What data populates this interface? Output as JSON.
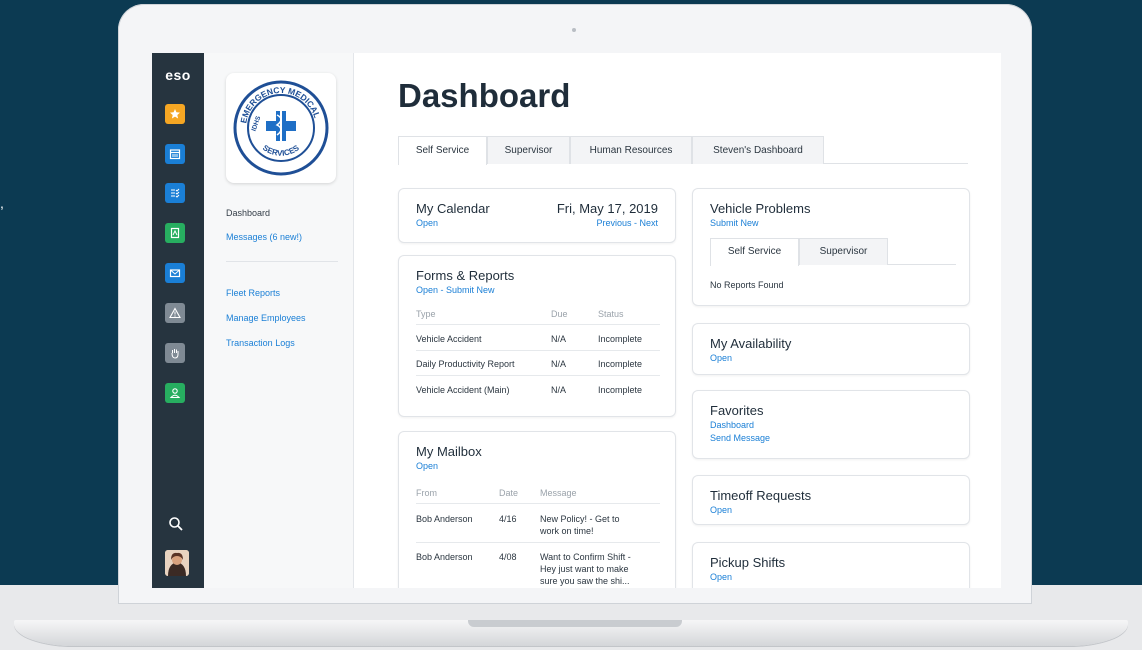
{
  "app": {
    "logo_text": "eso"
  },
  "stray_text": ",",
  "rail": {
    "items": [
      {
        "icon": "star-icon",
        "color": "#f5a623"
      },
      {
        "icon": "calendar-icon",
        "color": "#1a7fd6"
      },
      {
        "icon": "checklist-icon",
        "color": "#1a7fd6"
      },
      {
        "icon": "document-icon",
        "color": "#27ae60"
      },
      {
        "icon": "mail-icon",
        "color": "#1a7fd6"
      },
      {
        "icon": "warning-icon",
        "color": "#7f8a94"
      },
      {
        "icon": "hand-icon",
        "color": "#7f8a94"
      },
      {
        "icon": "person-icon",
        "color": "#27ae60"
      }
    ]
  },
  "sidebar": {
    "logo_text_top": "EMERGENCY MEDICAL",
    "logo_text_bottom": "SERVICES",
    "logo_text_side": "IDHS",
    "dashboard": "Dashboard",
    "messages": "Messages (6 new!)",
    "fleet_reports": "Fleet Reports",
    "manage_employees": "Manage Employees",
    "transaction_logs": "Transaction Logs"
  },
  "main": {
    "title": "Dashboard",
    "tabs": [
      "Self Service",
      "Supervisor",
      "Human Resources",
      "Steven's Dashboard"
    ]
  },
  "calendar": {
    "title": "My Calendar",
    "open": "Open",
    "date": "Fri, May 17, 2019",
    "nav": "Previous - Next"
  },
  "forms": {
    "title": "Forms & Reports",
    "links": "Open - Submit New",
    "headers": [
      "Type",
      "Due",
      "Status"
    ],
    "rows": [
      [
        "Vehicle Accident",
        "N/A",
        "Incomplete"
      ],
      [
        "Daily Productivity Report",
        "N/A",
        "Incomplete"
      ],
      [
        "Vehicle Accident (Main)",
        "N/A",
        "Incomplete"
      ]
    ]
  },
  "mailbox": {
    "title": "My Mailbox",
    "open": "Open",
    "headers": [
      "From",
      "Date",
      "Message"
    ],
    "rows": [
      {
        "from": "Bob Anderson",
        "date": "4/16",
        "msg1": "New Policy! - Get to",
        "msg2": "work on time!",
        "msg3": ""
      },
      {
        "from": "Bob Anderson",
        "date": "4/08",
        "msg1": "Want to Confirm Shift -",
        "msg2": "Hey just want to make",
        "msg3": "sure you saw the shi..."
      }
    ]
  },
  "vehicle": {
    "title": "Vehicle Problems",
    "submit": "Submit New",
    "tabs": [
      "Self Service",
      "Supervisor"
    ],
    "empty": "No Reports Found"
  },
  "availability": {
    "title": "My Availability",
    "open": "Open"
  },
  "favorites": {
    "title": "Favorites",
    "link1": "Dashboard",
    "link2": "Send Message"
  },
  "timeoff": {
    "title": "Timeoff Requests",
    "open": "Open"
  },
  "pickup": {
    "title": "Pickup Shifts",
    "open": "Open"
  }
}
